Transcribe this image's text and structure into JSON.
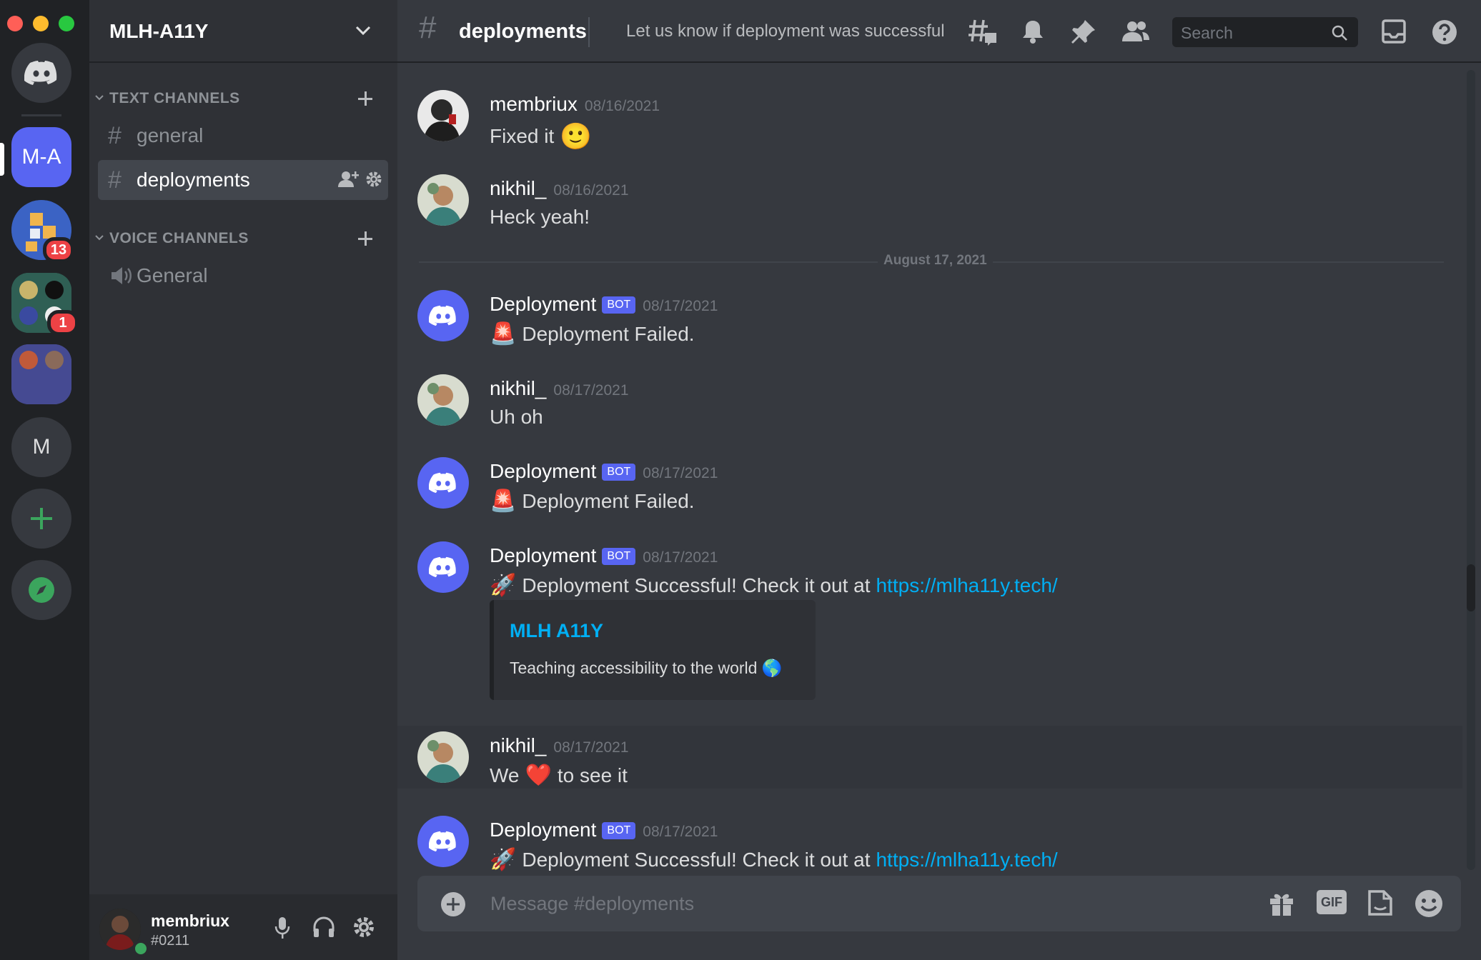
{
  "window": {
    "colors": {
      "close": "#ff5f57",
      "minimize": "#febc2e",
      "maximize": "#28c840"
    }
  },
  "servers": {
    "items": [
      {
        "label": "",
        "icon": "discord-home-icon"
      },
      {
        "label": "M-A"
      },
      {
        "label": "",
        "badge": "13"
      },
      {
        "label": "",
        "badge": "1"
      },
      {
        "label": ""
      },
      {
        "label": "M"
      },
      {
        "label": "",
        "icon": "add-server-icon"
      },
      {
        "label": "",
        "icon": "explore-icon"
      }
    ]
  },
  "sidebar": {
    "server_name": "MLH-A11Y",
    "text_category": "TEXT CHANNELS",
    "voice_category": "VOICE CHANNELS",
    "text_channels": [
      {
        "name": "general"
      },
      {
        "name": "deployments",
        "selected": true
      }
    ],
    "voice_channels": [
      {
        "name": "General"
      }
    ]
  },
  "user": {
    "name": "membriux",
    "tag": "#0211",
    "status_color": "#3ba55d"
  },
  "channel": {
    "name": "deployments",
    "topic": "Let us know if deployment was successful",
    "search_placeholder": "Search"
  },
  "messages": [
    {
      "author": "membriux",
      "date": "08/16/2021",
      "text": "Fixed it",
      "emoji": "🙂"
    },
    {
      "author": "nikhil_",
      "date": "08/16/2021",
      "text": "Heck yeah!"
    },
    {
      "author": "Deployment",
      "bot_tag": "BOT",
      "date": "08/17/2021",
      "emoji": "🚨",
      "text": "Deployment Failed."
    },
    {
      "author": "nikhil_",
      "date": "08/17/2021",
      "text": "Uh oh"
    },
    {
      "author": "Deployment",
      "bot_tag": "BOT",
      "date": "08/17/2021",
      "emoji": "🚨",
      "text": "Deployment Failed."
    },
    {
      "author": "Deployment",
      "bot_tag": "BOT",
      "date": "08/17/2021",
      "emoji": "🚀",
      "text": "Deployment Successful! Check it out at",
      "link": "https://mlha11y.tech/",
      "embed": {
        "title": "MLH A11Y",
        "description": "Teaching accessibility to the world",
        "emoji": "🌎"
      }
    },
    {
      "author": "nikhil_",
      "date": "08/17/2021",
      "text_before": "We",
      "emoji": "❤️",
      "text_after": "to see it"
    },
    {
      "author": "Deployment",
      "bot_tag": "BOT",
      "date": "08/17/2021",
      "emoji": "🚀",
      "text": "Deployment Successful! Check it out at",
      "link": "https://mlha11y.tech/"
    }
  ],
  "date_divider": "August 17, 2021",
  "composer": {
    "placeholder": "Message #deployments",
    "gif_label": "GIF"
  }
}
